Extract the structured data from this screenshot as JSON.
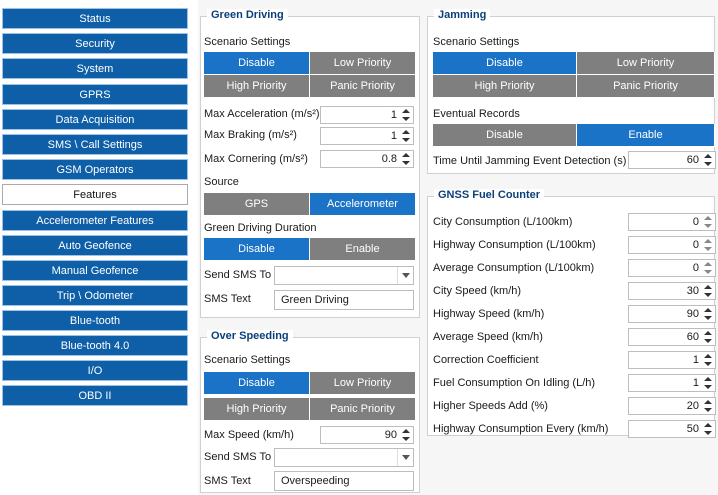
{
  "sidebar": {
    "items": [
      {
        "label": "Status"
      },
      {
        "label": "Security"
      },
      {
        "label": "System"
      },
      {
        "label": "GPRS"
      },
      {
        "label": "Data Acquisition"
      },
      {
        "label": "SMS \\ Call Settings"
      },
      {
        "label": "GSM Operators"
      },
      {
        "label": "Features"
      },
      {
        "label": "Accelerometer Features"
      },
      {
        "label": "Auto Geofence"
      },
      {
        "label": "Manual Geofence"
      },
      {
        "label": "Trip \\ Odometer"
      },
      {
        "label": "Blue-tooth"
      },
      {
        "label": "Blue-tooth 4.0"
      },
      {
        "label": "I/O"
      },
      {
        "label": "OBD II"
      }
    ],
    "active_index": 7
  },
  "green_driving": {
    "title": "Green Driving",
    "scenario_label": "Scenario Settings",
    "scenario": [
      "Disable",
      "Low Priority",
      "High Priority",
      "Panic Priority"
    ],
    "scenario_selected": "Disable",
    "max_accel_label": "Max Acceleration (m/s²)",
    "max_accel": "1",
    "max_braking_label": "Max Braking (m/s²)",
    "max_braking": "1",
    "max_cornering_label": "Max Cornering (m/s²)",
    "max_cornering": "0.8",
    "source_label": "Source",
    "source": [
      "GPS",
      "Accelerometer"
    ],
    "source_selected": "Accelerometer",
    "duration_label": "Green Driving Duration",
    "duration": [
      "Disable",
      "Enable"
    ],
    "duration_selected": "Disable",
    "send_sms_label": "Send SMS To",
    "send_sms_value": "",
    "sms_text_label": "SMS Text",
    "sms_text": "Green Driving"
  },
  "over_speeding": {
    "title": "Over Speeding",
    "scenario_label": "Scenario Settings",
    "scenario": [
      "Disable",
      "Low Priority",
      "High Priority",
      "Panic Priority"
    ],
    "scenario_selected": "Disable",
    "max_speed_label": "Max Speed (km/h)",
    "max_speed": "90",
    "send_sms_label": "Send SMS To",
    "send_sms_value": "",
    "sms_text_label": "SMS Text",
    "sms_text": "Overspeeding"
  },
  "jamming": {
    "title": "Jamming",
    "scenario_label": "Scenario Settings",
    "scenario": [
      "Disable",
      "Low Priority",
      "High Priority",
      "Panic Priority"
    ],
    "scenario_selected": "Disable",
    "eventual_label": "Eventual Records",
    "eventual": [
      "Disable",
      "Enable"
    ],
    "eventual_selected": "Enable",
    "time_label": "Time Until Jamming Event Detection (s)",
    "time_value": "60"
  },
  "gnss": {
    "title": "GNSS Fuel Counter",
    "fields": [
      {
        "label": "City Consumption (L/100km)",
        "value": "0",
        "disabled": true
      },
      {
        "label": "Highway Consumption (L/100km)",
        "value": "0",
        "disabled": true
      },
      {
        "label": "Average Consumption (L/100km)",
        "value": "0",
        "disabled": true
      },
      {
        "label": "City Speed (km/h)",
        "value": "30",
        "disabled": false
      },
      {
        "label": "Highway Speed (km/h)",
        "value": "90",
        "disabled": false
      },
      {
        "label": "Average Speed (km/h)",
        "value": "60",
        "disabled": false
      },
      {
        "label": "Correction Coefficient",
        "value": "1",
        "disabled": false
      },
      {
        "label": "Fuel Consumption On Idling (L/h)",
        "value": "1",
        "disabled": false
      },
      {
        "label": "Higher Speeds Add (%)",
        "value": "20",
        "disabled": false
      },
      {
        "label": "Highway Consumption Every (km/h)",
        "value": "50",
        "disabled": false
      }
    ]
  },
  "colors": {
    "accent": "#1a73c7",
    "sidebar": "#0e5fa8",
    "inactive": "#7f7f7f",
    "group_title": "#0b3f7a"
  }
}
